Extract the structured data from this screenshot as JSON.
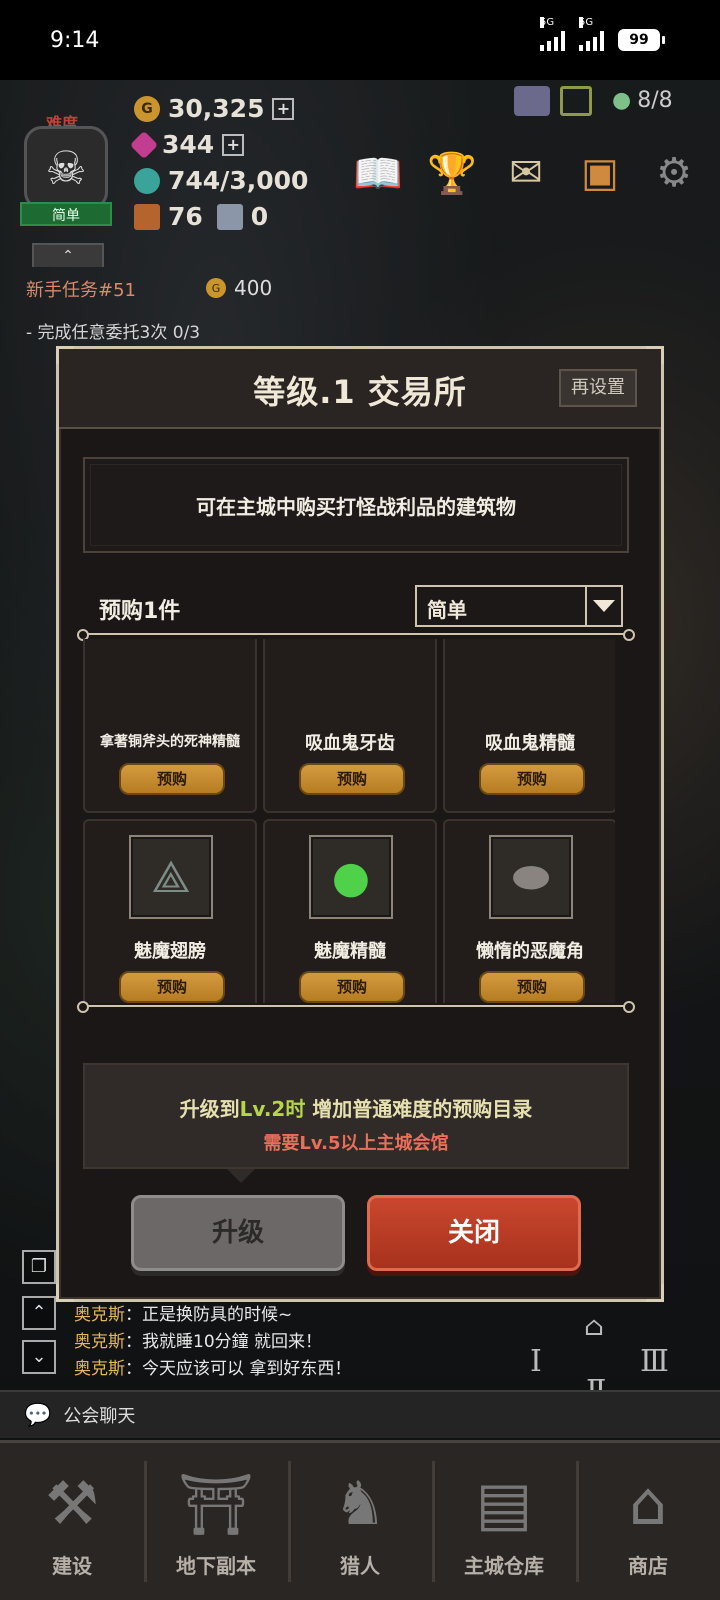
{
  "status_bar": {
    "time": "9:14",
    "net1": "5G",
    "net2": "5G",
    "battery": "99"
  },
  "hud": {
    "difficulty_label": "难度",
    "difficulty_name": "简单",
    "gold": "30,325",
    "gems": "344",
    "energy": "744/3,000",
    "box_count": "76",
    "cube_count": "0",
    "party": "8/8",
    "collapse_arrow": "⌃"
  },
  "quest": {
    "title": "新手任务#51",
    "reward": "400",
    "desc": "- 完成任意委托3次 0/3"
  },
  "modal": {
    "title": "等级.1 交易所",
    "reset_label": "再设置",
    "description": "可在主城中购买打怪战利品的建筑物",
    "prebuy_label": "预购1件",
    "difficulty_select": "简单",
    "items": [
      {
        "name": "拿著铜斧头的死神精髓",
        "button": "预购",
        "icon": "essence-icon"
      },
      {
        "name": "吸血鬼牙齿",
        "button": "预购",
        "icon": "fang-icon"
      },
      {
        "name": "吸血鬼精髓",
        "button": "预购",
        "icon": "essence-icon"
      },
      {
        "name": "魅魔翅膀",
        "button": "预购",
        "icon": "wing-icon"
      },
      {
        "name": "魅魔精髓",
        "button": "预购",
        "icon": "slime-icon"
      },
      {
        "name": "懒惰的恶魔角",
        "button": "预购",
        "icon": "horn-icon"
      },
      {
        "name": "",
        "button": "",
        "icon": "slime-icon"
      },
      {
        "name": "",
        "button": "",
        "icon": "fish-icon"
      },
      {
        "name": "",
        "button": "",
        "icon": "claw-icon"
      }
    ],
    "upgrade_prefix": "升级到",
    "upgrade_level": "Lv.2时",
    "upgrade_suffix": " 增加普通难度的预购目录",
    "requirement": "需要Lv.5以上主城会馆",
    "upgrade_button": "升级",
    "close_button": "关闭"
  },
  "chat": {
    "lines": [
      {
        "who": "奥克斯",
        "text": "：正是换防具的时候~"
      },
      {
        "who": "奥克斯",
        "text": "：我就睡10分鐘 就回来！"
      },
      {
        "who": "奥克斯",
        "text": "：今天应该可以 拿到好东西！"
      }
    ],
    "guild_label": "公会聊天"
  },
  "nav": [
    {
      "label": "建设",
      "icon": "hammer-icon"
    },
    {
      "label": "地下副本",
      "icon": "dungeon-gate-icon"
    },
    {
      "label": "猎人",
      "icon": "hunter-icon"
    },
    {
      "label": "主城仓库",
      "icon": "chest-icon"
    },
    {
      "label": "商店",
      "icon": "shop-icon"
    }
  ],
  "colors": {
    "modal_bg": "#1b1716",
    "accent_gold": "#d49b3e",
    "close_red": "#b83a24",
    "level_green": "#b6d64a",
    "requirement_red": "#e86f5a"
  }
}
